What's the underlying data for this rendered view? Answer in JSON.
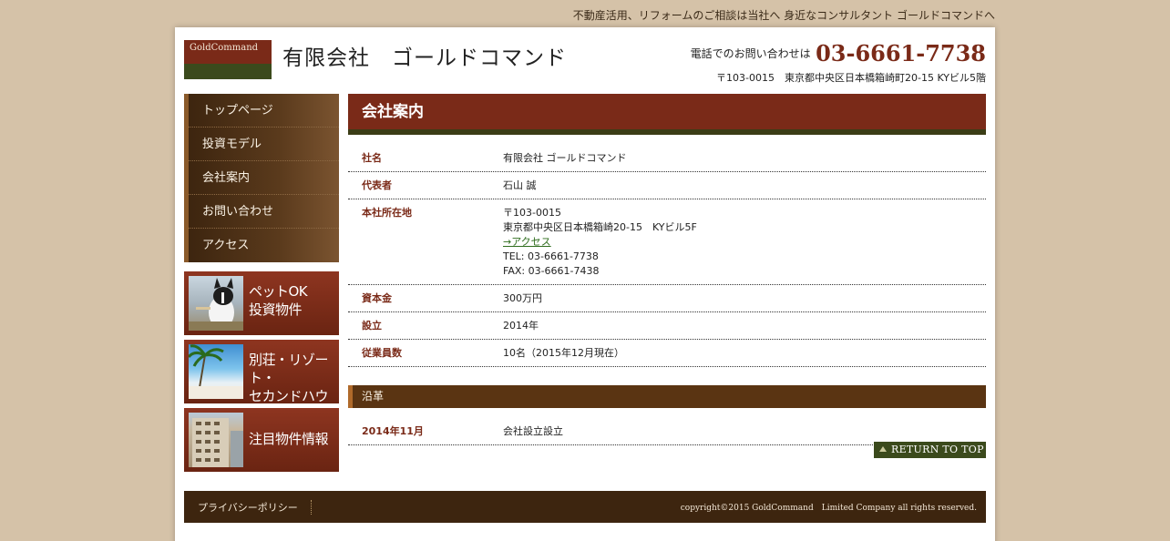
{
  "tagline": "不動産活用、リフォームのご相談は当社へ 身近なコンサルタント ゴールドコマンドへ",
  "header": {
    "logo_text": "GoldCommand",
    "company_name": "有限会社　ゴールドコマンド",
    "phone_label": "電話でのお問い合わせは",
    "phone_number": "03-6661-7738",
    "address": "〒103-0015　東京都中央区日本橋箱崎町20-15 KYビル5階"
  },
  "nav": {
    "items": [
      {
        "label": "トップページ"
      },
      {
        "label": "投資モデル"
      },
      {
        "label": "会社案内"
      },
      {
        "label": "お問い合わせ"
      },
      {
        "label": "アクセス"
      }
    ]
  },
  "banners": [
    {
      "line1": "ペットOK",
      "line2": "投資物件",
      "icon": "dog-photo"
    },
    {
      "line1": "別荘・リゾート・",
      "line2": "セカンドハウス",
      "icon": "beach-photo"
    },
    {
      "line1": "注目物件情報",
      "line2": "",
      "icon": "building-photo"
    }
  ],
  "main": {
    "heading": "会社案内",
    "company_info": [
      {
        "label": "社名",
        "value": "有限会社 ゴールドコマンド"
      },
      {
        "label": "代表者",
        "value": "石山 誠"
      },
      {
        "label": "本社所在地",
        "postal": "〒103-0015",
        "address": "東京都中央区日本橋箱崎20-15　KYビル5F",
        "access_link": "→アクセス",
        "tel": "TEL: 03-6661-7738",
        "fax": "FAX: 03-6661-7438"
      },
      {
        "label": "資本金",
        "value": "300万円"
      },
      {
        "label": "設立",
        "value": "2014年"
      },
      {
        "label": "従業員数",
        "value": "10名（2015年12月現在）"
      }
    ],
    "history_heading": "沿革",
    "history": [
      {
        "date": "2014年11月",
        "event": "会社設立設立"
      }
    ],
    "return_top": "RETURN TO TOP"
  },
  "footer": {
    "privacy": "プライバシーポリシー",
    "copyright": "copyright©2015 GoldCommand　Limited Company all rights reserved."
  },
  "colors": {
    "background": "#d5c2a8",
    "brand": "#7a2a18",
    "accent_green": "#3b4a1c",
    "dark_brown": "#3d250f"
  }
}
